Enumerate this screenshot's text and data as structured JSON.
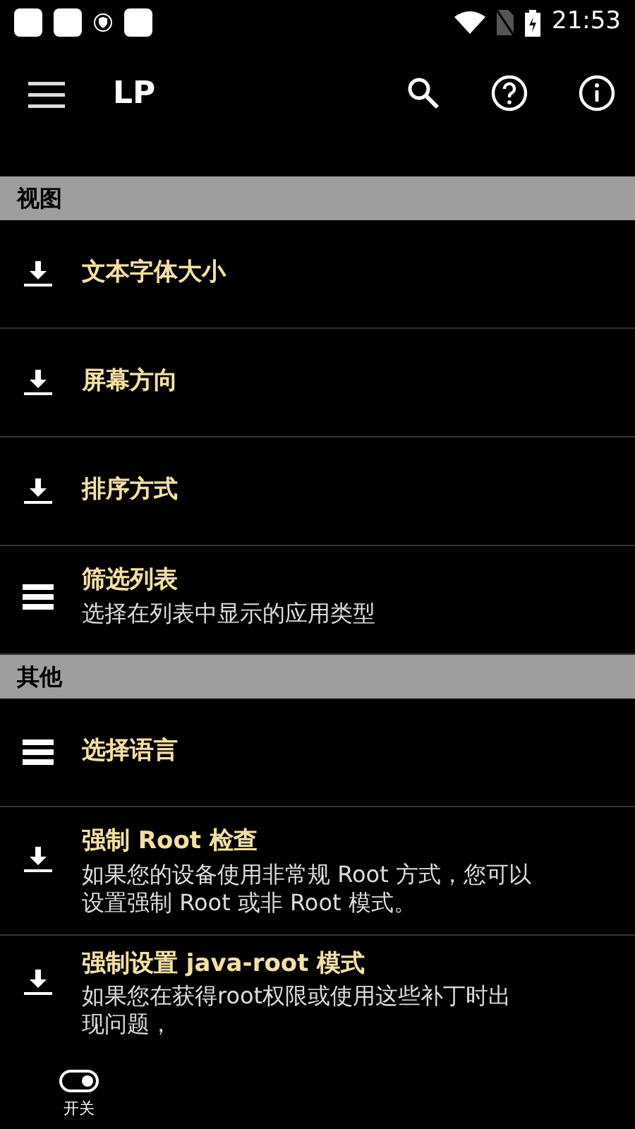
{
  "status_bar": {
    "time": "21:53"
  },
  "app_bar": {
    "title": "LP"
  },
  "sections": [
    {
      "header": "视图",
      "items": [
        {
          "kind": "download",
          "title": "文本字体大小"
        },
        {
          "kind": "download",
          "title": "屏幕方向"
        },
        {
          "kind": "download",
          "title": "排序方式"
        },
        {
          "kind": "list",
          "title": "筛选列表",
          "subtitle": "选择在列表中显示的应用类型"
        }
      ]
    },
    {
      "header": "其他",
      "items": [
        {
          "kind": "list",
          "title": "选择语言"
        },
        {
          "kind": "download",
          "title": "强制 Root 检查",
          "subtitle": "如果您的设备使用非常规 Root 方式，您可以设置强制 Root 或非 Root 模式。"
        },
        {
          "kind": "download",
          "title": "强制设置 java-root 模式",
          "subtitle": "如果您在获得root权限或使用这些补丁时出现问题，"
        }
      ]
    }
  ],
  "bottom_nav": [
    {
      "label": "开关",
      "selected": true
    }
  ]
}
